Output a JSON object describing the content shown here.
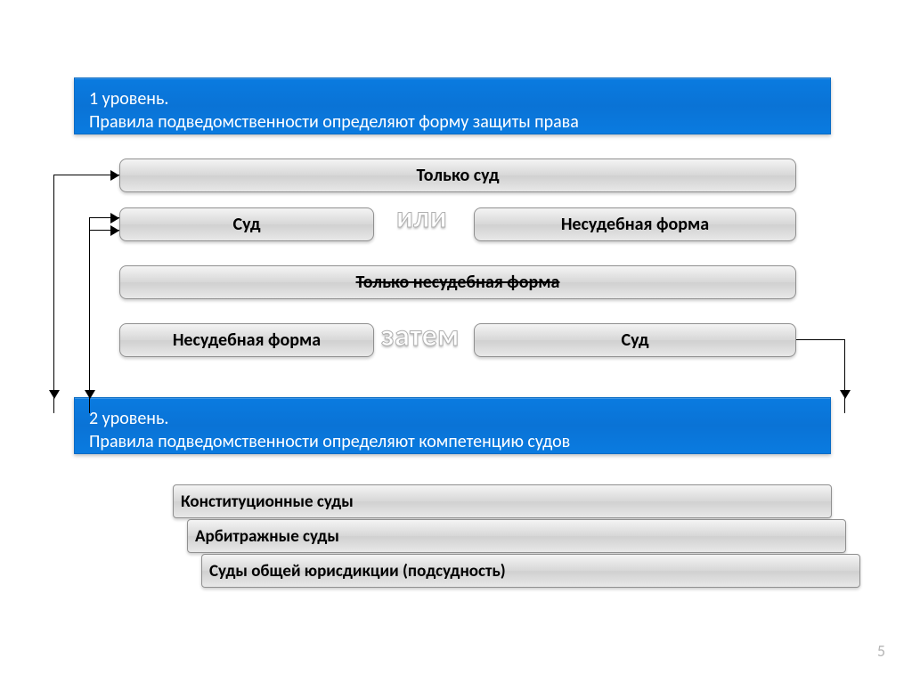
{
  "level1": {
    "title_line1": "1 уровень.",
    "title_line2": "Правила подведомственности определяют форму защиты права"
  },
  "row1": {
    "box": "Только суд"
  },
  "row2": {
    "left": "Суд",
    "mid_word": "или",
    "right": "Несудебная форма"
  },
  "row3": {
    "box": "Только несудебная форма"
  },
  "row4": {
    "left": "Несудебная форма",
    "mid_word": "затем",
    "right": "Суд"
  },
  "level2": {
    "title_line1": "2 уровень.",
    "title_line2": "Правила подведомственности определяют компетенцию судов"
  },
  "courts": {
    "a": "Конституционные суды",
    "b": "Арбитражные суды",
    "c": "Суды общей юрисдикции (подсудность)"
  },
  "page": "5"
}
